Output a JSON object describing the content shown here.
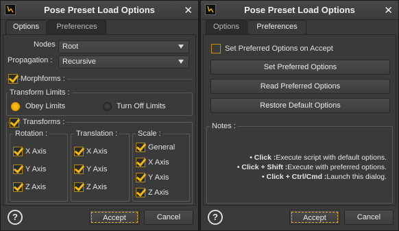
{
  "dialog_title": "Pose Preset Load Options",
  "close_glyph": "✕",
  "tabs": {
    "options": "Options",
    "preferences": "Preferences"
  },
  "options_tab": {
    "nodes_label": "Nodes :",
    "nodes_value": "Root",
    "propagation_label": "Propagation :",
    "propagation_value": "Recursive",
    "morphforms_label": "Morphforms :",
    "morphforms_checked": true,
    "transform_limits": {
      "legend": "Transform Limits :",
      "obey_label": "Obey Limits",
      "turn_off_label": "Turn Off Limits",
      "selected": "obey"
    },
    "transforms": {
      "legend": "Transforms :",
      "checked": true,
      "rotation": {
        "legend": "Rotation :",
        "items": [
          "X Axis",
          "Y Axis",
          "Z Axis"
        ]
      },
      "translation": {
        "legend": "Translation :",
        "items": [
          "X Axis",
          "Y Axis",
          "Z Axis"
        ]
      },
      "scale": {
        "legend": "Scale :",
        "items": [
          "General",
          "X Axis",
          "Y Axis",
          "Z Axis"
        ]
      }
    }
  },
  "preferences_tab": {
    "set_preferred_on_accept": "Set Preferred Options on Accept",
    "set_preferred_on_accept_checked": false,
    "buttons": {
      "set_preferred": "Set Preferred Options",
      "read_preferred": "Read Preferred Options",
      "restore_default": "Restore Default Options"
    },
    "notes": {
      "legend": "Notes :",
      "lines": [
        {
          "key": "• Click :",
          "text": "Execute script with default options."
        },
        {
          "key": "• Click + Shift :",
          "text": "Execute with preferred options."
        },
        {
          "key": "• Click + Ctrl/Cmd :",
          "text": "Launch this dialog."
        }
      ]
    }
  },
  "footer": {
    "help_glyph": "?",
    "accept": "Accept",
    "cancel": "Cancel"
  },
  "colors": {
    "accent": "#f2b80b",
    "background": "#3a3a3a",
    "titlebar": "#444444"
  },
  "icons": [
    "app-icon",
    "close-icon",
    "help-icon",
    "dropdown-arrow-icon",
    "checkmark-icon",
    "radio-icon"
  ]
}
